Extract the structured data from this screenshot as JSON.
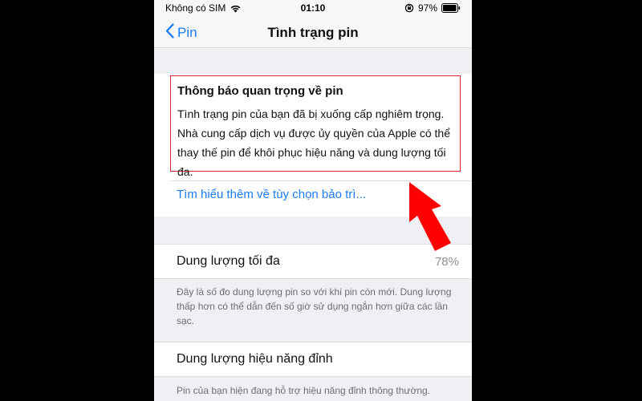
{
  "status_bar": {
    "carrier": "Không có SIM",
    "time": "01:10",
    "battery": "97%"
  },
  "nav": {
    "back_label": "Pin",
    "title": "Tình trạng pin"
  },
  "alert": {
    "title": "Thông báo quan trọng về pin",
    "lines": [
      "Tình trạng pin của bạn đã bị xuống cấp nghiêm trọng.",
      "Nhà cung cấp dịch vụ được ủy quyền của Apple có thể",
      "thay thế pin để khôi phục hiệu năng và dung lượng tối",
      "đa."
    ],
    "link": "Tìm hiểu thêm về tùy chọn bảo trì..."
  },
  "maximum_capacity": {
    "label": "Dung lượng tối đa",
    "value": "78%",
    "note": "Đây là số đo dung lượng pin so với khi pin còn mới. Dung lượng thấp hơn có thể dẫn đến số giờ sử dụng ngắn hơn giữa các lần sạc."
  },
  "peak_performance": {
    "label": "Dung lượng hiệu năng đỉnh",
    "note": "Pin của bạn hiện đang hỗ trợ hiệu năng đỉnh thông thường."
  },
  "colors": {
    "link_blue": "#1a7cf5",
    "highlight_red": "#d9262e",
    "arrow_red": "#ff0000"
  }
}
